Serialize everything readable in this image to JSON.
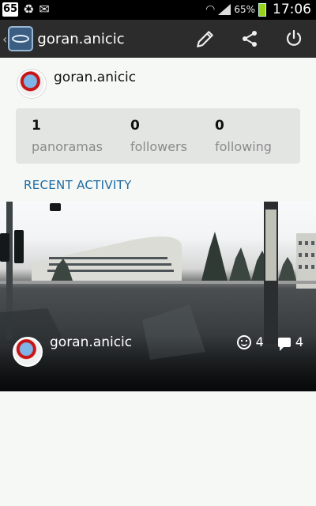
{
  "status_bar": {
    "notification_badge": "65",
    "notification_icons": [
      "recycle-icon",
      "mail-icon"
    ],
    "battery_percent": "65%",
    "time": "17:06"
  },
  "action_bar": {
    "title": "goran.anicic",
    "actions": [
      "pencil-icon",
      "share-icon",
      "power-icon"
    ]
  },
  "profile": {
    "username": "goran.anicic"
  },
  "stats": [
    {
      "value": "1",
      "label": "panoramas"
    },
    {
      "value": "0",
      "label": "followers"
    },
    {
      "value": "0",
      "label": "following"
    }
  ],
  "recent_activity": {
    "title": "RECENT ACTIVITY",
    "item": {
      "username": "goran.anicic",
      "likes": "4",
      "comments": "4"
    }
  },
  "colors": {
    "action_bar": "#2c2c2c",
    "accent": "#1e6aa0",
    "stats_bg": "#e3e5e3",
    "page_bg": "#f6f8f6"
  }
}
